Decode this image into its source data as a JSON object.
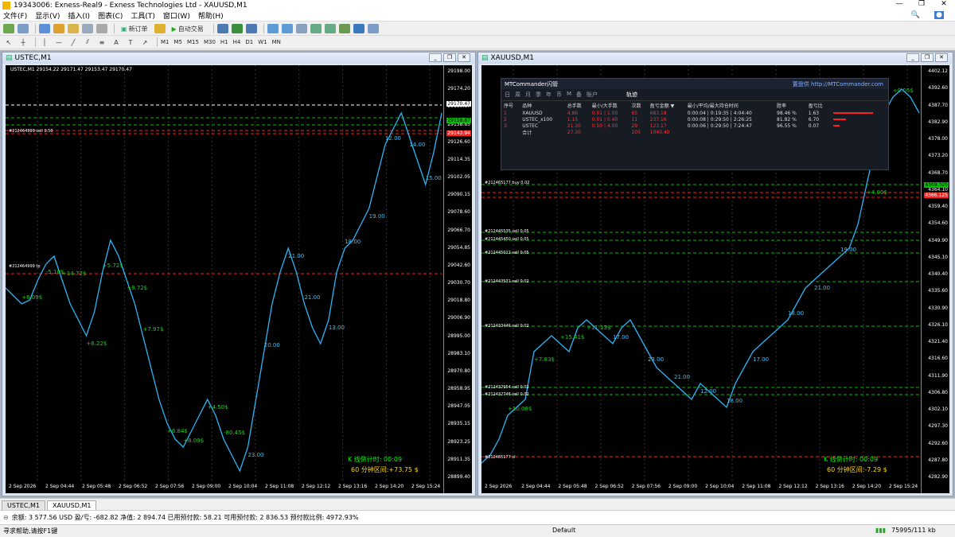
{
  "window": {
    "title": "19343006: Exness-Real9 - Exness Technologies Ltd - XAUUSD,M1"
  },
  "menu": [
    "文件(F)",
    "显示(V)",
    "插入(I)",
    "图表(C)",
    "工具(T)",
    "窗口(W)",
    "帮助(H)"
  ],
  "toolbar": {
    "new_order": "新订单",
    "auto_trading": "自动交易"
  },
  "timeframes": [
    "M1",
    "M5",
    "M15",
    "M30",
    "H1",
    "H4",
    "D1",
    "W1",
    "MN"
  ],
  "left_chart": {
    "title": "USTEC,M1",
    "symbol_info": "USTEC,M1  29154.22 29171.47 29153.47 29170.47",
    "y_ticks": [
      "29198.00",
      "29174.20",
      "29150.67",
      "29138.85",
      "29126.60",
      "29114.35",
      "29102.05",
      "29090.15",
      "29078.60",
      "29066.70",
      "29054.85",
      "29042.60",
      "29030.70",
      "29018.80",
      "29006.90",
      "28995.00",
      "28983.10",
      "28970.80",
      "28958.95",
      "28947.05",
      "28935.15",
      "28923.25",
      "28911.35",
      "28899.40"
    ],
    "x_ticks": [
      "2 Sep 2026",
      "2 Sep 04:44",
      "2 Sep 05:48",
      "2 Sep 06:52",
      "2 Sep 07:56",
      "2 Sep 09:00",
      "2 Sep 10:04",
      "2 Sep 11:08",
      "2 Sep 12:12",
      "2 Sep 13:16",
      "2 Sep 14:20",
      "2 Sep 15:24"
    ],
    "price_tag_1": "29170.47",
    "price_tag_2": "29158.87",
    "price_tag_3": "29143.94",
    "orders": [
      "#212464999 sell 0.50",
      "#212464999 tp"
    ],
    "trade_labels": [
      "+6.09$",
      "-5.10$",
      "+14.72$",
      "+6.22$",
      "+5.72$",
      "+8.72$",
      "+7.97$",
      "+6.84$",
      "+8.09$",
      "+4.50$",
      "-80.45$",
      "23.00",
      "20.00",
      "21.00",
      "21.00",
      "13.00",
      "18.00",
      "19.00",
      "12.00",
      "14.00",
      "15.00"
    ],
    "countdown": "K 线倒计时: 00:09",
    "interval": "60 分钟区间:+73.75 $"
  },
  "right_chart": {
    "title": "XAUUSD,M1",
    "y_ticks": [
      "4402.12",
      "4392.60",
      "4387.70",
      "4382.90",
      "4378.00",
      "4373.20",
      "4368.70",
      "4364.10",
      "4359.40",
      "4354.60",
      "4349.90",
      "4345.10",
      "4340.40",
      "4335.60",
      "4330.90",
      "4326.10",
      "4321.40",
      "4316.60",
      "4311.90",
      "4306.80",
      "4302.10",
      "4297.30",
      "4292.60",
      "4287.80",
      "4282.90"
    ],
    "x_ticks": [
      "2 Sep 2026",
      "2 Sep 04:44",
      "2 Sep 05:48",
      "2 Sep 06:52",
      "2 Sep 07:56",
      "2 Sep 09:00",
      "2 Sep 10:04",
      "2 Sep 11:08",
      "2 Sep 12:12",
      "2 Sep 13:16",
      "2 Sep 14:20",
      "2 Sep 15:24"
    ],
    "price_tag_1": "4369.325",
    "price_tag_2": "4366.125",
    "orders": [
      "#212465177 buy 0.02",
      "#212445535 sell 0.05",
      "#212445450 sell 0.05",
      "#212445012 sell 0.05",
      "#212443531 sell 0.02",
      "#212433446 sell 0.02",
      "#212432954 sell 0.02",
      "#212432746 sell 0.02",
      "#212465177 sl"
    ],
    "trade_labels": [
      "+10.08$",
      "+7.83$",
      "+15.41$",
      "+11.13$",
      "17.00",
      "23.00",
      "21.00",
      "12.00",
      "18.00",
      "17.00",
      "18.00",
      "21.00",
      "19.00",
      "+4.00$",
      "+0.05$"
    ],
    "countdown": "K 线倒计时: 00:09",
    "interval": "60 分钟区间:-7.29 $"
  },
  "mtc_panel": {
    "title": "MTCommander闪管",
    "link": "置盘供 http://MTCommander.com",
    "tabs": [
      "日",
      "周",
      "月",
      "季",
      "年",
      "币",
      "M",
      "备",
      "账户",
      "轨迹"
    ],
    "headers": [
      "序号",
      "品种",
      "总手数",
      "最小/大手数",
      "次数",
      "盈亏金额 ▼",
      "最小/平均/最大持仓时间",
      "胜率",
      "盈亏比"
    ],
    "rows": [
      [
        "1",
        "XAUUSD",
        "4.86",
        "0.01 | 1.00",
        "65",
        "683.18",
        "0:00:04 | 0:19:35 | 4:04:40",
        "98.46 %",
        "1.63"
      ],
      [
        "2",
        "USTEC_x100",
        "1.15",
        "0.01 | 0.40",
        "11",
        "237.16",
        "0:00:08 | 0:29:50 | 2:26:25",
        "81.82 %",
        "6.70"
      ],
      [
        "3",
        "USTEC",
        "21.30",
        "0.50 | 4.00",
        "29",
        "123.17",
        "0:00:06 | 0:29:50 | 7:24:47",
        "96.55 %",
        "0.07"
      ]
    ],
    "total": [
      "合计",
      "27.30",
      "105",
      "1040.49"
    ]
  },
  "tabs": [
    "USTEC,M1",
    "XAUUSD,M1"
  ],
  "account": "余额: 3 577.56 USD  盈/亏: -682.82  净值: 2 894.74  已用预付款: 58.21  可用预付款: 2 836.53  预付款比例: 4972.93%",
  "status": {
    "help": "寻求帮助,请按F1键",
    "profile": "Default",
    "traffic": "75995/111 kb"
  }
}
